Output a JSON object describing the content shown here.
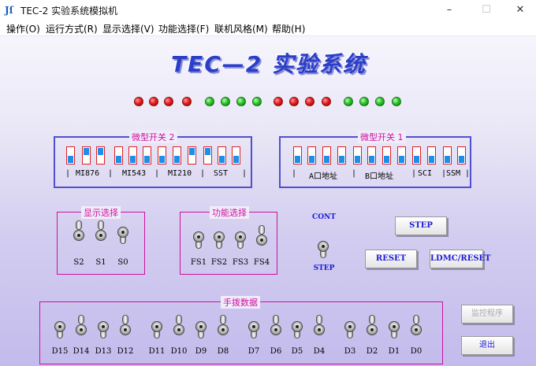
{
  "window": {
    "title": "TEC-2 实验系统模拟机",
    "icon_glyph": "Jſ",
    "minimize": "–",
    "maximize": "☐",
    "close": "✕"
  },
  "menu": [
    "操作(O)",
    "运行方式(R)",
    "显示选择(V)",
    "功能选择(F)",
    "联机风格(M)",
    "帮助(H)"
  ],
  "main_title": "TEC—2 实验系统",
  "leds": [
    "red",
    "red",
    "red",
    "red",
    "green",
    "green",
    "green",
    "green",
    "red",
    "red",
    "red",
    "red",
    "green",
    "green",
    "green",
    "green"
  ],
  "switch2": {
    "label": "微型开关 2",
    "states": [
      "down",
      "up",
      "up",
      "down",
      "down",
      "down",
      "down",
      "down",
      "up",
      "up",
      "down",
      "down",
      "down"
    ],
    "segments": [
      "MI876",
      "MI543",
      "MI210",
      "SST"
    ],
    "separators": [
      "|",
      "|",
      "|",
      "|",
      "|"
    ]
  },
  "switch1": {
    "label": "微型开关 1",
    "states": [
      "down",
      "down",
      "down",
      "down",
      "down",
      "down",
      "down",
      "down",
      "down",
      "down",
      "down",
      "down",
      "down",
      "down",
      "down"
    ],
    "segments": [
      "A口地址",
      "B口地址",
      "SCI",
      "SSM"
    ],
    "separators": [
      "|",
      "|",
      "|",
      "|",
      "|"
    ]
  },
  "display_select": {
    "label": "显示选择",
    "toggles": [
      {
        "name": "S2",
        "state": "up"
      },
      {
        "name": "S1",
        "state": "up"
      },
      {
        "name": "S0",
        "state": "down"
      }
    ]
  },
  "function_select": {
    "label": "功能选择",
    "toggles": [
      {
        "name": "FS1",
        "state": "down"
      },
      {
        "name": "FS2",
        "state": "down"
      },
      {
        "name": "FS3",
        "state": "down"
      },
      {
        "name": "FS4",
        "state": "up"
      }
    ]
  },
  "cont_step": {
    "top": "CONT",
    "bottom": "STEP",
    "state": "down"
  },
  "buttons": {
    "step": "STEP",
    "reset": "RESET",
    "ldmc": "LDMC/RESET",
    "monitor": "监控程序",
    "exit": "退出"
  },
  "manual_data": {
    "label": "手拨数据",
    "toggles": [
      {
        "name": "D15",
        "state": "down"
      },
      {
        "name": "D14",
        "state": "up"
      },
      {
        "name": "D13",
        "state": "down"
      },
      {
        "name": "D12",
        "state": "up"
      },
      {
        "name": "D11",
        "state": "down"
      },
      {
        "name": "D10",
        "state": "up"
      },
      {
        "name": "D9",
        "state": "down"
      },
      {
        "name": "D8",
        "state": "up"
      },
      {
        "name": "D7",
        "state": "down"
      },
      {
        "name": "D6",
        "state": "up"
      },
      {
        "name": "D5",
        "state": "down"
      },
      {
        "name": "D4",
        "state": "up"
      },
      {
        "name": "D3",
        "state": "down"
      },
      {
        "name": "D2",
        "state": "up"
      },
      {
        "name": "D1",
        "state": "down"
      },
      {
        "name": "D0",
        "state": "up"
      }
    ]
  },
  "colors": {
    "frame_blue": "#4a4ac8",
    "frame_pink": "#d10f9e",
    "title_blue": "#2a3fc8"
  }
}
